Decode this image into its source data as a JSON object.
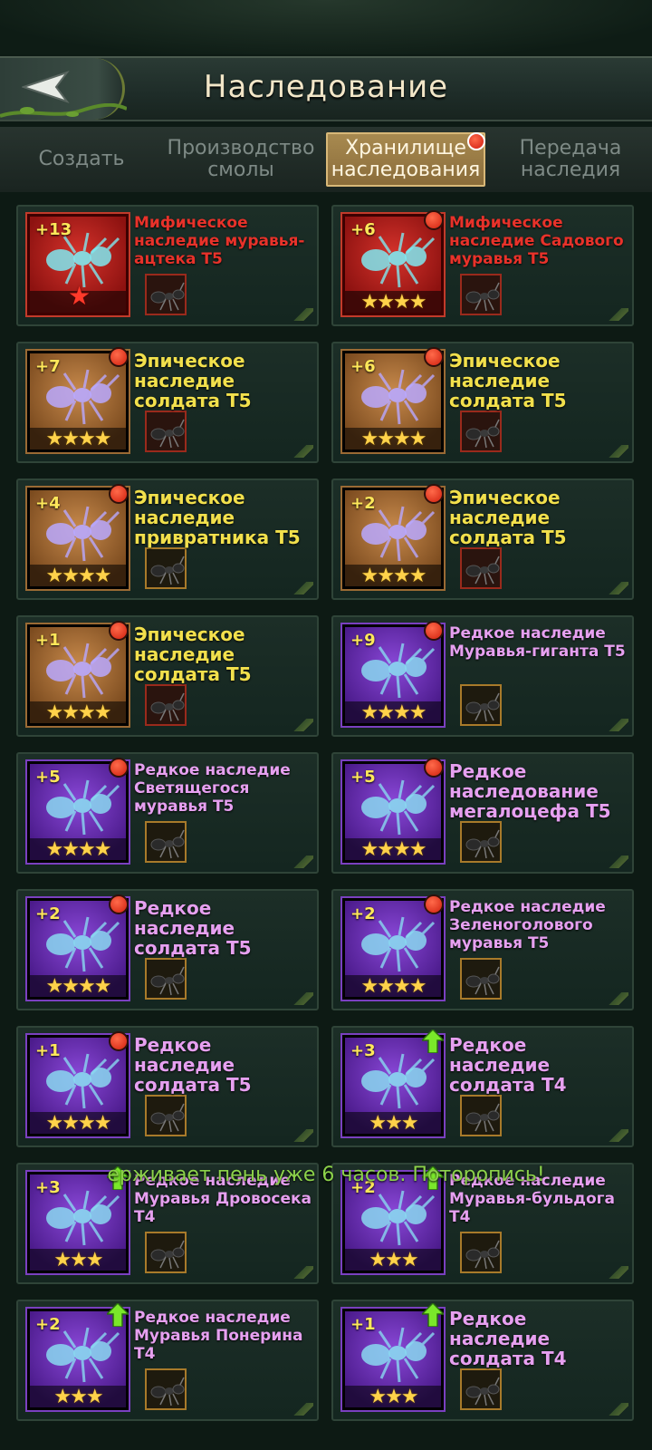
{
  "header": {
    "title": "Наследование"
  },
  "tabs": [
    {
      "label": "Создать",
      "active": false
    },
    {
      "label": "Производство смолы",
      "active": false
    },
    {
      "label": "Хранилище наследования",
      "active": true
    },
    {
      "label": "Передача наследия",
      "active": false
    }
  ],
  "items": [
    {
      "name": "Мифическое наследие муравья-ацтека T5",
      "level": "+13",
      "rarity": "mythic",
      "stars": "",
      "badge": "none"
    },
    {
      "name": "Мифическое наследие Садового муравья T5",
      "level": "+6",
      "rarity": "mythic",
      "stars": "★★★★",
      "badge": "red-dot"
    },
    {
      "name": "Эпическое наследие солдата T5",
      "level": "+7",
      "rarity": "epic",
      "stars": "★★★★",
      "badge": "red-dot"
    },
    {
      "name": "Эпическое наследие солдата T5",
      "level": "+6",
      "rarity": "epic",
      "stars": "★★★★",
      "badge": "red-dot"
    },
    {
      "name": "Эпическое наследие привратника T5",
      "level": "+4",
      "rarity": "epic",
      "stars": "★★★★",
      "badge": "red-dot"
    },
    {
      "name": "Эпическое наследие солдата T5",
      "level": "+2",
      "rarity": "epic",
      "stars": "★★★★",
      "badge": "red-dot"
    },
    {
      "name": "Эпическое наследие солдата T5",
      "level": "+1",
      "rarity": "epic",
      "stars": "★★★★",
      "badge": "red-dot"
    },
    {
      "name": "Редкое наследие Муравья-гиганта T5",
      "level": "+9",
      "rarity": "rare",
      "stars": "★★★★",
      "badge": "red-dot"
    },
    {
      "name": "Редкое наследие Светящегося муравья T5",
      "level": "+5",
      "rarity": "rare",
      "stars": "★★★★",
      "badge": "red-dot"
    },
    {
      "name": "Редкое наследование мегалоцефа T5",
      "level": "+5",
      "rarity": "rare",
      "stars": "★★★★",
      "badge": "red-dot"
    },
    {
      "name": "Редкое наследие солдата T5",
      "level": "+2",
      "rarity": "rare",
      "stars": "★★★★",
      "badge": "red-dot"
    },
    {
      "name": "Редкое наследие Зеленоголового муравья T5",
      "level": "+2",
      "rarity": "rare",
      "stars": "★★★★",
      "badge": "red-dot"
    },
    {
      "name": "Редкое наследие солдата T5",
      "level": "+1",
      "rarity": "rare",
      "stars": "★★★★",
      "badge": "red-dot"
    },
    {
      "name": "Редкое наследие солдата T4",
      "level": "+3",
      "rarity": "rare",
      "stars": "★★★",
      "badge": "up-arrow"
    },
    {
      "name": "Редкое наследие Муравья Дровосека T4",
      "level": "+3",
      "rarity": "rare",
      "stars": "★★★",
      "badge": "up-arrow"
    },
    {
      "name": "Редкое наследие Муравья-бульдога T4",
      "level": "+2",
      "rarity": "rare",
      "stars": "★★★",
      "badge": "up-arrow"
    },
    {
      "name": "Редкое наследие Муравья Понерина T4",
      "level": "+2",
      "rarity": "rare",
      "stars": "★★★",
      "badge": "up-arrow"
    },
    {
      "name": "Редкое наследие солдата T4",
      "level": "+1",
      "rarity": "rare",
      "stars": "★★★",
      "badge": "up-arrow"
    }
  ],
  "marquee": "ерживает пень уже 6 часов. Поторопись!",
  "colors": {
    "mythic": "#e8322a",
    "epic": "#f2e04c",
    "rare": "#e6a0f0",
    "accent": "#a88a50"
  }
}
